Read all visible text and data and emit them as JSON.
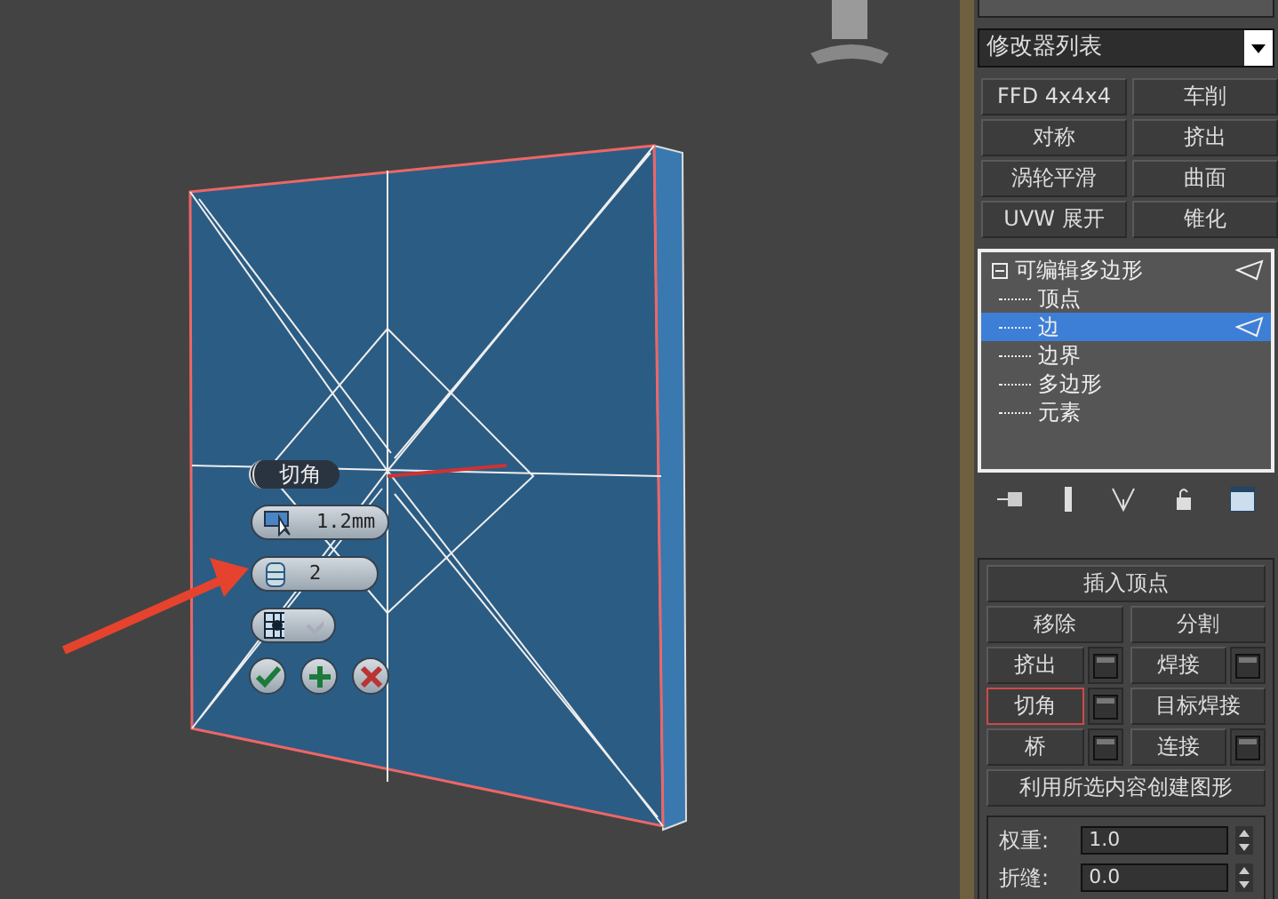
{
  "viewport": {
    "caddy": {
      "title": "切角",
      "amount": "1.2mm",
      "segments": "2"
    }
  },
  "panel": {
    "modifier_list": "修改器列表",
    "modifier_buttons": [
      "FFD 4x4x4",
      "车削",
      "对称",
      "挤出",
      "涡轮平滑",
      "曲面",
      "UVW 展开",
      "锥化"
    ],
    "stack": [
      {
        "label": "可编辑多边形",
        "expanded": true,
        "selected": false,
        "children": [
          {
            "label": "顶点",
            "selected": false
          },
          {
            "label": "边",
            "selected": true
          },
          {
            "label": "边界",
            "selected": false
          },
          {
            "label": "多边形",
            "selected": false
          },
          {
            "label": "元素",
            "selected": false
          }
        ]
      }
    ],
    "rollout": {
      "buttons": [
        {
          "kind": "full",
          "label": "插入顶点",
          "selected": false
        },
        {
          "kind": "half",
          "label": "移除",
          "settings": false,
          "selected": false
        },
        {
          "kind": "half",
          "label": "分割",
          "settings": false,
          "selected": false
        },
        {
          "kind": "half",
          "label": "挤出",
          "settings": true,
          "selected": false
        },
        {
          "kind": "half",
          "label": "焊接",
          "settings": true,
          "selected": false
        },
        {
          "kind": "half",
          "label": "切角",
          "settings": true,
          "selected": true
        },
        {
          "kind": "half",
          "label": "目标焊接",
          "settings": false,
          "selected": false
        },
        {
          "kind": "half",
          "label": "桥",
          "settings": true,
          "selected": false
        },
        {
          "kind": "half",
          "label": "连接",
          "settings": true,
          "selected": false
        },
        {
          "kind": "full",
          "label": "利用所选内容创建图形",
          "selected": false
        }
      ],
      "spinners": [
        {
          "label": "权重:",
          "value": "1.0"
        },
        {
          "label": "折缝:",
          "value": "0.0"
        }
      ]
    }
  }
}
